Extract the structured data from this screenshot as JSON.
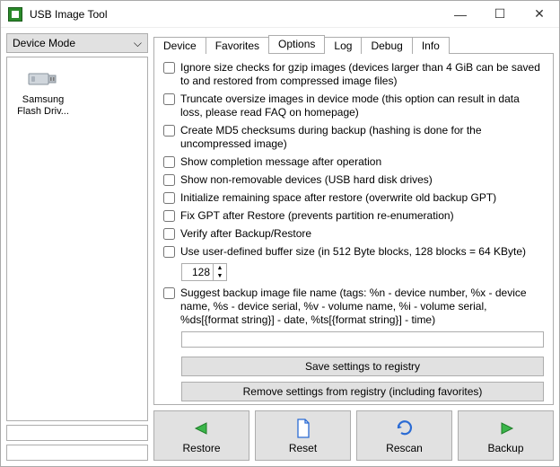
{
  "window": {
    "title": "USB Image Tool"
  },
  "mode": {
    "selected": "Device Mode"
  },
  "device": {
    "name": "Samsung",
    "name2": "Flash Driv..."
  },
  "tabs": {
    "device": "Device",
    "favorites": "Favorites",
    "options": "Options",
    "log": "Log",
    "debug": "Debug",
    "info": "Info",
    "active": "options"
  },
  "options": {
    "ignore_size": "Ignore size checks for gzip images (devices larger than 4 GiB can be saved to and restored from compressed image files)",
    "truncate": "Truncate oversize images in device mode (this option can result in data loss, please read FAQ on homepage)",
    "md5": "Create MD5 checksums during backup (hashing is done for the uncompressed image)",
    "completion": "Show completion message after operation",
    "nonremovable": "Show non-removable devices (USB hard disk drives)",
    "initialize": "Initialize remaining space after restore (overwrite old backup GPT)",
    "fixgpt": "Fix GPT after Restore (prevents partition re-enumeration)",
    "verify": "Verify after Backup/Restore",
    "buffer": "Use user-defined buffer size (in 512 Byte blocks, 128 blocks = 64 KByte)",
    "buffer_value": "128",
    "suggest": "Suggest backup image file name (tags: %n - device number, %x - device name, %s - device serial, %v - volume name, %i - volume serial, %ds[{format string}] - date, %ts[{format string}] - time)",
    "filename_value": ""
  },
  "buttons": {
    "save_registry": "Save settings to registry",
    "remove_registry": "Remove settings from registry (including favorites)",
    "restore": "Restore",
    "reset": "Reset",
    "rescan": "Rescan",
    "backup": "Backup"
  }
}
